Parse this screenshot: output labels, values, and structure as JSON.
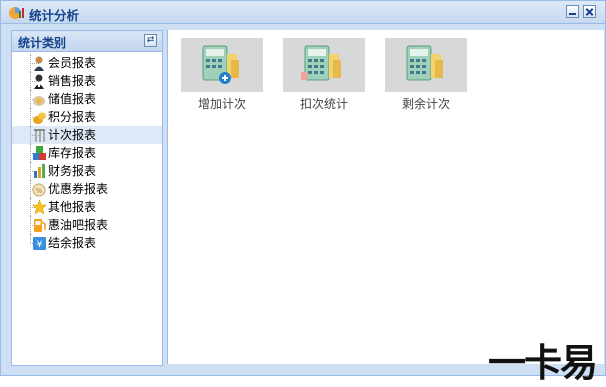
{
  "window": {
    "title": "统计分析"
  },
  "left_panel": {
    "title": "统计类别",
    "items": [
      {
        "label": "会员报表",
        "icon": "member-icon"
      },
      {
        "label": "销售报表",
        "icon": "sales-icon"
      },
      {
        "label": "储值报表",
        "icon": "stored-value-icon"
      },
      {
        "label": "积分报表",
        "icon": "points-icon"
      },
      {
        "label": "计次报表",
        "icon": "count-icon",
        "selected": true
      },
      {
        "label": "库存报表",
        "icon": "inventory-icon"
      },
      {
        "label": "财务报表",
        "icon": "finance-icon"
      },
      {
        "label": "优惠券报表",
        "icon": "coupon-icon"
      },
      {
        "label": "其他报表",
        "icon": "star-icon"
      },
      {
        "label": "惠油吧报表",
        "icon": "fuel-icon"
      },
      {
        "label": "结余报表",
        "icon": "balance-icon"
      }
    ]
  },
  "main": {
    "tiles": [
      {
        "label": "增加计次",
        "icon": "add-count-icon"
      },
      {
        "label": "扣次统计",
        "icon": "deduct-count-icon"
      },
      {
        "label": "剩余计次",
        "icon": "remaining-count-icon"
      }
    ]
  },
  "watermark": "一卡易",
  "colors": {
    "border": "#99bbe8",
    "title": "#15428b",
    "selected": "#dfe8f6",
    "tile_bg": "#d8d8d8"
  }
}
